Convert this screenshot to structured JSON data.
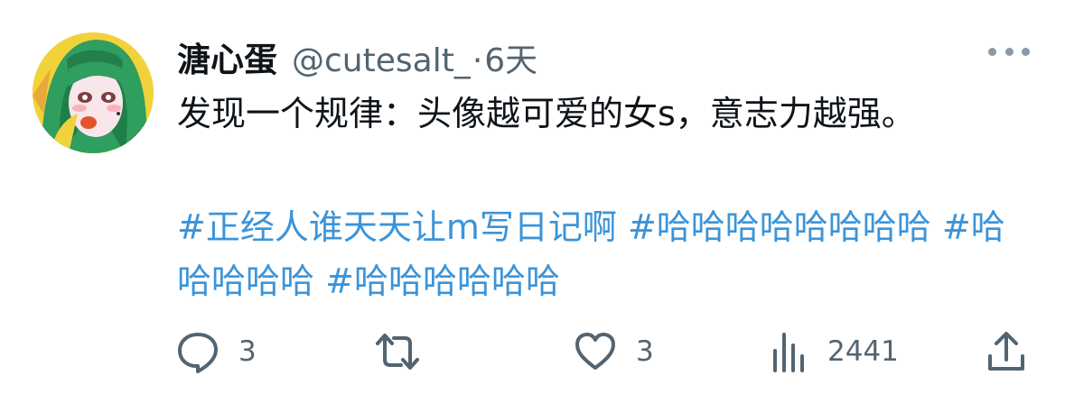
{
  "author": {
    "display_name": "溏心蛋",
    "handle": "@cutesalt_",
    "separator": "·",
    "time": "6天",
    "avatar": "avatar-illustration-green-hair-girl"
  },
  "tweet": {
    "text": "发现一个规律：头像越可爱的女s，意志力越强。",
    "hashtags": [
      "#正经人谁天天让m写日记啊",
      "#哈哈哈哈哈哈哈哈",
      "#哈哈哈哈哈",
      "#哈哈哈哈哈哈"
    ]
  },
  "actions": {
    "reply": {
      "icon": "reply-icon",
      "count": "3"
    },
    "retweet": {
      "icon": "retweet-icon",
      "count": ""
    },
    "like": {
      "icon": "heart-icon",
      "count": "3"
    },
    "views": {
      "icon": "views-icon",
      "count": "2441"
    },
    "share": {
      "icon": "share-icon",
      "count": ""
    }
  },
  "more": {
    "icon": "more-icon"
  },
  "colors": {
    "text": "#0f1419",
    "secondary": "#536471",
    "link": "#3b94d9",
    "icon": "#536471"
  }
}
